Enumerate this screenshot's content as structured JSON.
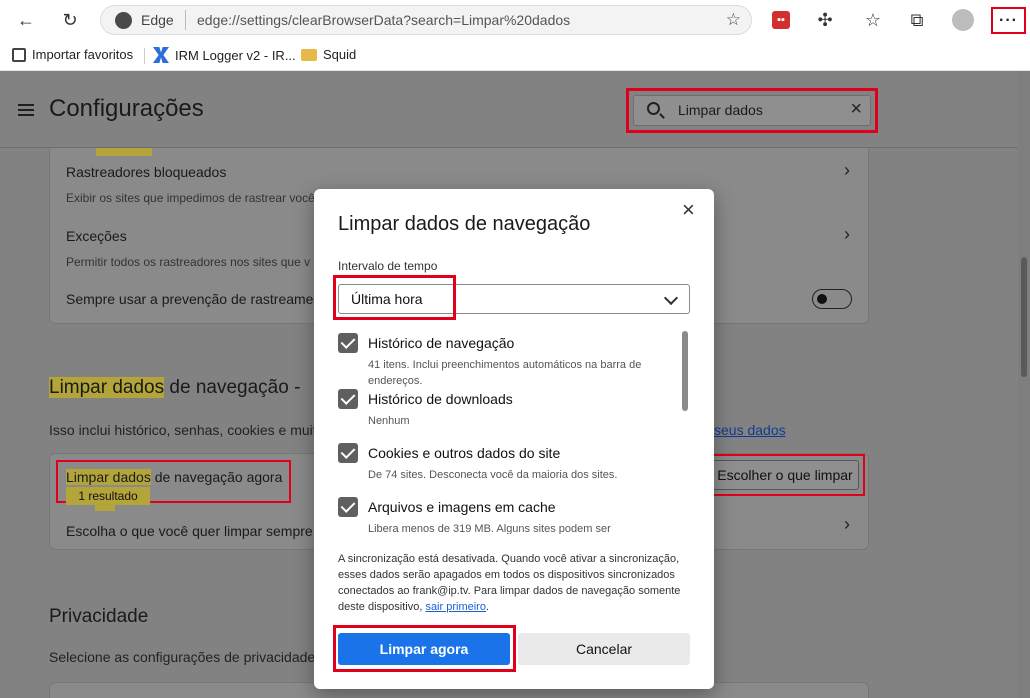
{
  "browser": {
    "edge_label": "Edge",
    "url": "edge://settings/clearBrowserData?search=Limpar%20dados",
    "more_label": "···",
    "ext_label": "▪▪"
  },
  "bookmarks": [
    {
      "label": "Importar favoritos"
    },
    {
      "label": "IRM Logger v2 - IR..."
    },
    {
      "label": "Squid"
    }
  ],
  "settings": {
    "title": "Configurações",
    "search_value": "Limpar dados",
    "tracker_card": {
      "rows": [
        {
          "title": "Rastreadores bloqueados",
          "subtitle": "Exibir os sites que impedimos de rastrear você"
        },
        {
          "title": "Exceções",
          "subtitle": "Permitir todos os rastreadores nos sites que v"
        },
        {
          "title": "Sempre usar a prevenção de rastreamen"
        }
      ]
    },
    "clear_section": {
      "title_highlight": "Limpar dados",
      "title_rest": " de navegação -",
      "subtitle": "Isso inclui histórico, senhas, cookies e muito",
      "manage_link": "seus dados",
      "row1_title_highlight": "Limpar dados",
      "row1_title_rest": " de navegação agora",
      "row1_badge": "1 resultado",
      "choose_button": "Escolher o que limpar",
      "row2_title": "Escolha o que você quer limpar sempre"
    },
    "privacy_section": {
      "title": "Privacidade",
      "subtitle": "Selecione as configurações de privacidade"
    }
  },
  "dialog": {
    "title": "Limpar dados de navegação",
    "range_label": "Intervalo de tempo",
    "range_value": "Última hora",
    "items": [
      {
        "title": "Histórico de navegação",
        "desc": "41 itens. Inclui preenchimentos automáticos na barra de endereços.",
        "checked": true
      },
      {
        "title": "Histórico de downloads",
        "desc": "Nenhum",
        "checked": true
      },
      {
        "title": "Cookies e outros dados do site",
        "desc": "De 74 sites. Desconecta você da maioria dos sites.",
        "checked": true
      },
      {
        "title": "Arquivos e imagens em cache",
        "desc": "Libera menos de 319 MB. Alguns sites podem ser",
        "checked": true
      }
    ],
    "sync_text": "A sincronização está desativada. Quando você ativar a sincronização, esses dados serão apagados em todos os dispositivos sincronizados conectados ao frank@ip.tv. Para limpar dados de navegação somente deste dispositivo, ",
    "sync_link": "sair primeiro",
    "sync_end": ".",
    "primary_button": "Limpar agora",
    "secondary_button": "Cancelar"
  },
  "colors": {
    "accent": "#1a73e8",
    "annotation_red": "#e0001a",
    "search_highlight": "#b3a53a"
  }
}
